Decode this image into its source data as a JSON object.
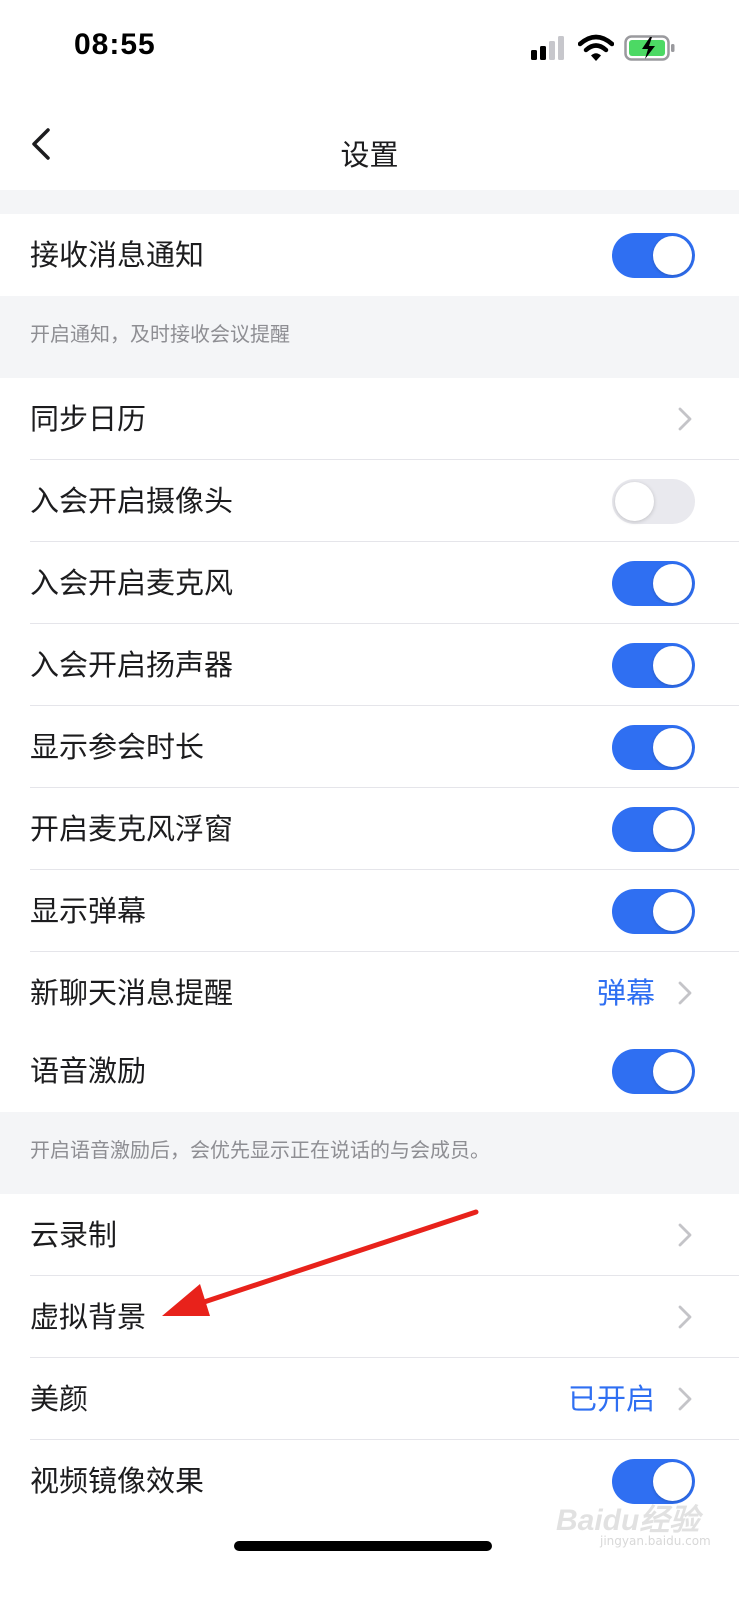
{
  "status_bar": {
    "time": "08:55",
    "signal": "cellular-signal",
    "wifi": "wifi",
    "battery": "battery-charging"
  },
  "nav": {
    "title": "设置",
    "back": "chevron-left"
  },
  "colors": {
    "accent": "#2f6ff2",
    "toggle_off": "#e9e9ee",
    "group_bg": "#f4f5f7",
    "note_text": "#8e8e93",
    "annotation_arrow": "#e8221b"
  },
  "groups": [
    {
      "rows": [
        {
          "label": "接收消息通知",
          "control": "toggle",
          "on": true
        }
      ],
      "note": "开启通知，及时接收会议提醒"
    },
    {
      "rows": [
        {
          "label": "同步日历",
          "control": "chevron"
        },
        {
          "label": "入会开启摄像头",
          "control": "toggle",
          "on": false
        },
        {
          "label": "入会开启麦克风",
          "control": "toggle",
          "on": true
        },
        {
          "label": "入会开启扬声器",
          "control": "toggle",
          "on": true
        },
        {
          "label": "显示参会时长",
          "control": "toggle",
          "on": true
        },
        {
          "label": "开启麦克风浮窗",
          "control": "toggle",
          "on": true
        },
        {
          "label": "显示弹幕",
          "control": "toggle",
          "on": true
        },
        {
          "label": "新聊天消息提醒",
          "control": "chevron",
          "value": "弹幕"
        },
        {
          "label": "语音激励",
          "control": "toggle",
          "on": true
        }
      ],
      "note": "开启语音激励后，会优先显示正在说话的与会成员。"
    },
    {
      "rows": [
        {
          "label": "云录制",
          "control": "chevron"
        },
        {
          "label": "虚拟背景",
          "control": "chevron"
        },
        {
          "label": "美颜",
          "control": "chevron",
          "value": "已开启"
        },
        {
          "label": "视频镜像效果",
          "control": "toggle",
          "on": true
        }
      ]
    }
  ],
  "watermark": {
    "text": "Baidu经验",
    "sub": "jingyan.baidu.com"
  }
}
